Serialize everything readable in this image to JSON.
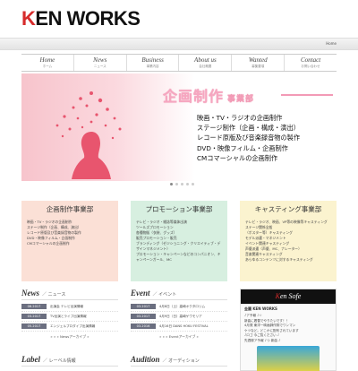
{
  "header": {
    "logo_k": "K",
    "logo_rest": "EN WORKS",
    "top_link": "Home"
  },
  "nav": [
    {
      "en": "Home",
      "jp": "ホーム"
    },
    {
      "en": "News",
      "jp": "ニュース"
    },
    {
      "en": "Business",
      "jp": "事業内容"
    },
    {
      "en": "About us",
      "jp": "会社概要"
    },
    {
      "en": "Wanted",
      "jp": "募集要項"
    },
    {
      "en": "Contact",
      "jp": "お問い合わせ"
    }
  ],
  "hero": {
    "title": "企画制作",
    "subtitle": "事業部",
    "lines": [
      "映画・TV・ラジオの企画制作",
      "ステージ制作（企画・構成・演出）",
      "レコード原版及び音楽録音物の製作",
      "DVD・映像フィルム・企画制作",
      "CMコマーシャルの企画制作"
    ],
    "accent": "#f6a6c0"
  },
  "divisions": [
    {
      "title": "企画制作事業部",
      "items": [
        "映画・TV・ラジオの企画制作",
        "ステージ制作（企画、構成、演出）",
        "レコード原版及び音楽録音物の製作",
        "DVD・映像フィルム・企画制作",
        "CMコマーシャルの企画制作"
      ]
    },
    {
      "title": "プロモーション事業部",
      "items": [
        "テレビ・ラジオ・雑誌等媒体出演",
        "ツールズプロモーション",
        "各種物販（衣装、グッズ）",
        "販売プロモーション・販売",
        "ブランディング（ゼジショニング・クリエイティブ・デザインマネジメント）",
        "プロモーション・キャンペーンなどのコンパニオン、キャンペーンガール、MC"
      ]
    },
    {
      "title": "キャスティング事業部",
      "items": [
        "テレビ・ラジオ、映画、VP等の映像等キャスティング",
        "ステージ関係全般",
        "（ポスター等）キャスティング",
        "モデル派遣・マネジメント",
        "イベント関連キャスティング",
        "声優派遣（声優、MC、ナレーター）",
        "音楽関連キャスティング",
        "あらゆるコンテンツに対するキャスティング"
      ]
    }
  ],
  "news": {
    "en": "News",
    "jp": "／ ニュース",
    "rows": [
      {
        "date": "06.2017",
        "text": "出演会 テレビ出演情報"
      },
      {
        "date": "03.2017",
        "text": "TV出演とライブ出演情報"
      },
      {
        "date": "05.2017",
        "text": "エンジェルプロダイブ出演情報"
      }
    ],
    "more": "» » » Newsアーカイブ »"
  },
  "event": {
    "en": "Event",
    "jp": "／ イベント",
    "rows": [
      {
        "date": "03.2017",
        "text": "4月8日（土）高崎オクタロリム"
      },
      {
        "date": "03.2017",
        "text": "4月9日（日）高崎ゲウモリア"
      },
      {
        "date": "03.2016",
        "text": "4月16日 DANS HOKU FESTIVAL"
      }
    ],
    "more": "» » » Eventアーカイブ »"
  },
  "twitter": {
    "banner_k": "K",
    "banner_rest": "en Sofe",
    "name": "金麗 KEN WORKS",
    "lines": [
      "♪ア予報 ♪☆",
      "新曲に着替でやりたいです！！",
      "4月発 東洋一映画師作詞でワンマン",
      "ケツなど。どこかに配布されています",
      "♪ロゴ 今ご覧ください ♪",
      "先週録ア予報 ♪つ 新曲 ♪"
    ]
  },
  "bottom": [
    {
      "en": "Label",
      "jp": "／ レーベル情報"
    },
    {
      "en": "Audition",
      "jp": "／ オーディション"
    }
  ]
}
